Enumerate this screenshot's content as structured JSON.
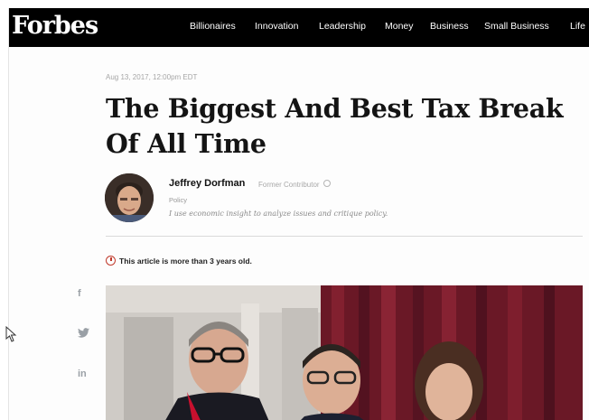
{
  "site": {
    "logo": "Forbes"
  },
  "nav": {
    "items": [
      "Billionaires",
      "Innovation",
      "Leadership",
      "Money",
      "Business",
      "Small Business",
      "Life"
    ]
  },
  "article": {
    "date": "Aug 13, 2017, 12:00pm EDT",
    "title": "The Biggest And Best Tax Break Of All Time",
    "author": {
      "name": "Jeffrey Dorfman",
      "role": "Former Contributor",
      "section": "Policy",
      "bio": "I use economic insight to analyze issues and critique policy."
    },
    "age_notice": "This article is more than 3 years old."
  },
  "share": {
    "facebook": "f",
    "twitter": "twitter-icon",
    "linkedin": "in"
  },
  "colors": {
    "topbar": "#000000",
    "notice_red": "#c0392b",
    "title": "#141414"
  }
}
